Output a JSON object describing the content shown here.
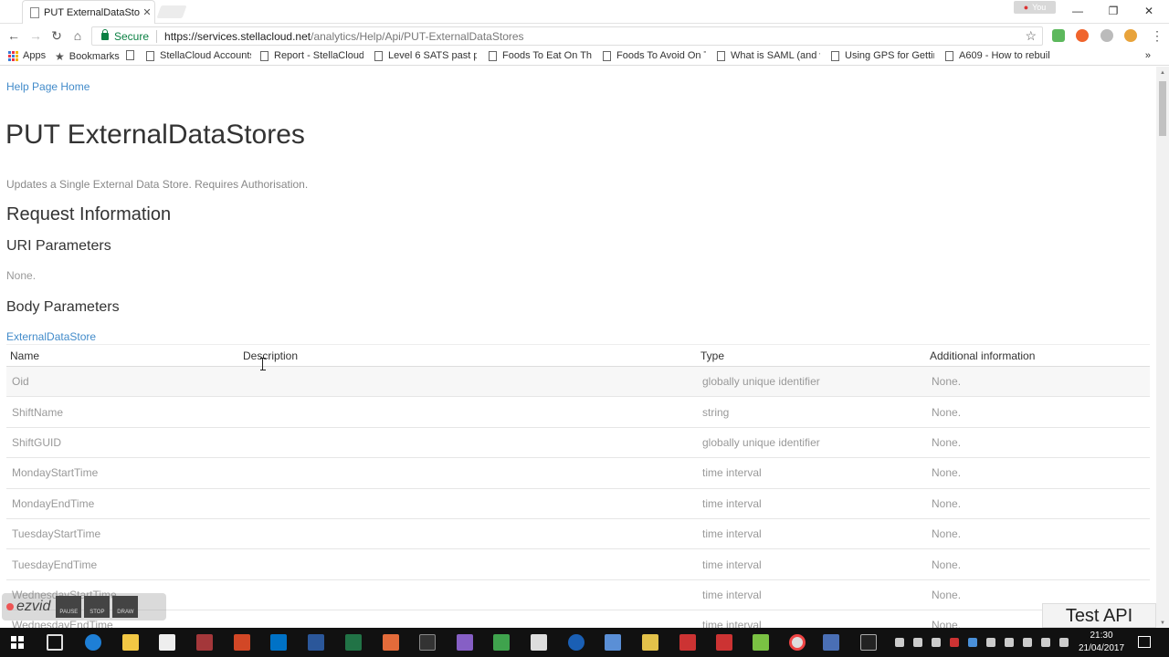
{
  "browser": {
    "tab_title": "PUT ExternalDataStores",
    "tab_close": "✕",
    "profile_label": "You",
    "window_controls": [
      "—",
      "❐",
      "✕"
    ],
    "secure_label": "Secure",
    "url_host": "https://services.stellacloud.net",
    "url_path": "/analytics/Help/Api/PUT-ExternalDataStores",
    "bookmarks": [
      {
        "label": "Apps",
        "icon": "apps-grid-icon"
      },
      {
        "label": "Bookmarks",
        "icon": "star-icon"
      },
      {
        "label": "",
        "icon": "document-icon"
      },
      {
        "label": "StellaCloud Accounts",
        "icon": "document-icon"
      },
      {
        "label": "Report - StellaCloud A",
        "icon": "document-icon"
      },
      {
        "label": "Level 6 SATS past pap",
        "icon": "document-icon"
      },
      {
        "label": "Foods To Eat On The C",
        "icon": "document-icon"
      },
      {
        "label": "Foods To Avoid On Th",
        "icon": "document-icon"
      },
      {
        "label": "What is SAML (and w",
        "icon": "document-icon"
      },
      {
        "label": "Using GPS for Getting",
        "icon": "document-icon"
      },
      {
        "label": "A609 - How to rebuild",
        "icon": "document-icon"
      }
    ],
    "bookmarks_more": "»"
  },
  "page": {
    "help_link": "Help Page Home",
    "title": "PUT ExternalDataStores",
    "summary": "Updates a Single External Data Store. Requires Authorisation.",
    "request_heading": "Request Information",
    "uri_heading": "URI Parameters",
    "uri_none": "None.",
    "body_heading": "Body Parameters",
    "body_type_link": "ExternalDataStore",
    "table": {
      "headers": [
        "Name",
        "Description",
        "Type",
        "Additional information"
      ],
      "rows": [
        [
          "Oid",
          "",
          "globally unique identifier",
          "None."
        ],
        [
          "ShiftName",
          "",
          "string",
          "None."
        ],
        [
          "ShiftGUID",
          "",
          "globally unique identifier",
          "None."
        ],
        [
          "MondayStartTime",
          "",
          "time interval",
          "None."
        ],
        [
          "MondayEndTime",
          "",
          "time interval",
          "None."
        ],
        [
          "TuesdayStartTime",
          "",
          "time interval",
          "None."
        ],
        [
          "TuesdayEndTime",
          "",
          "time interval",
          "None."
        ],
        [
          "WednesdayStartTime",
          "",
          "time interval",
          "None."
        ],
        [
          "WednesdayEndTime",
          "",
          "time interval",
          "None."
        ]
      ]
    }
  },
  "overlay": {
    "test_api": "Test API",
    "ezvid_logo": "ezvid",
    "ezvid_buttons": [
      "PAUSE",
      "STOP",
      "DRAW"
    ]
  },
  "taskbar": {
    "time": "21:30",
    "date": "21/04/2017"
  }
}
